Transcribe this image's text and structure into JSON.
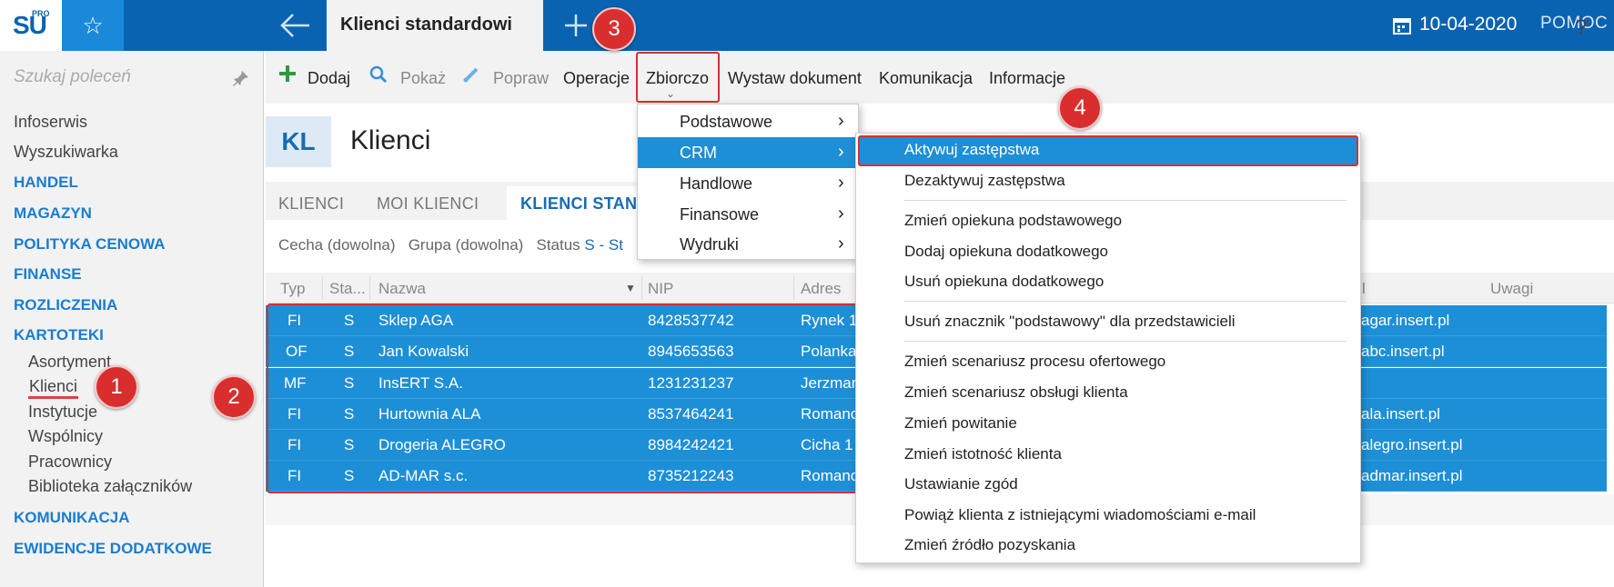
{
  "topbar": {
    "logo": "SU",
    "logo_sup": "PRO",
    "tab_title": "Klienci standardowi",
    "date": "10-04-2020",
    "help": "POMOC"
  },
  "sidebar": {
    "search_placeholder": "Szukaj poleceń",
    "items": [
      "Infoserwis",
      "Wyszukiwarka"
    ],
    "sections": [
      "HANDEL",
      "MAGAZYN",
      "POLITYKA CENOWA",
      "FINANSE",
      "ROZLICZENIA",
      "KARTOTEKI"
    ],
    "kartoteki_items": [
      "Asortyment",
      "Klienci",
      "Instytucje",
      "Wspólnicy",
      "Pracownicy",
      "Biblioteka załączników"
    ],
    "bottom_sections": [
      "KOMUNIKACJA",
      "EWIDENCJE DODATKOWE"
    ]
  },
  "toolbar": {
    "add": "Dodaj",
    "show": "Pokaż",
    "edit": "Popraw",
    "operations": "Operacje",
    "bulk": "Zbiorczo",
    "issue_document": "Wystaw dokument",
    "communication": "Komunikacja",
    "information": "Informacje",
    "help": "?"
  },
  "page": {
    "badge": "KL",
    "title": "Klienci"
  },
  "tabs": [
    "KLIENCI",
    "MOI KLIENCI",
    "KLIENCI STAN"
  ],
  "filters": {
    "feature": "Cecha (dowolna)",
    "group": "Grupa (dowolna)",
    "status_label": "Status",
    "status_value": "S - St"
  },
  "grid": {
    "headers": [
      "Typ",
      "Sta...",
      "Nazwa",
      "NIP",
      "Adres",
      "l",
      "Uwagi"
    ],
    "rows": [
      {
        "type": "FI",
        "status": "S",
        "name": "Sklep AGA",
        "nip": "8428537742",
        "address": "Rynek 1",
        "email": "agar.insert.pl"
      },
      {
        "type": "OF",
        "status": "S",
        "name": "Jan Kowalski",
        "nip": "8945653563",
        "address": "Polanka",
        "email": "abc.insert.pl"
      },
      {
        "type": "MF",
        "status": "S",
        "name": "InsERT S.A.",
        "nip": "1231231237",
        "address": "Jerzmar",
        "email": ""
      },
      {
        "type": "FI",
        "status": "S",
        "name": "Hurtownia ALA",
        "nip": "8537464241",
        "address": "Romanc",
        "email": "ala.insert.pl"
      },
      {
        "type": "FI",
        "status": "S",
        "name": "Drogeria ALEGRO",
        "nip": "8984242421",
        "address": "Cicha  1",
        "email": "alegro.insert.pl"
      },
      {
        "type": "FI",
        "status": "S",
        "name": "AD-MAR s.c.",
        "nip": "8735212243",
        "address": "Romanc",
        "email": "admar.insert.pl"
      }
    ]
  },
  "menu_bulk": [
    {
      "label": "Podstawowe",
      "arrow": "›"
    },
    {
      "label": "CRM",
      "arrow": "›"
    },
    {
      "label": "Handlowe",
      "arrow": "›"
    },
    {
      "label": "Finansowe",
      "arrow": "›"
    },
    {
      "label": "Wydruki",
      "arrow": "›"
    }
  ],
  "menu_crm": [
    "Aktywuj zastępstwa",
    "Dezaktywuj zastępstwa",
    "Zmień opiekuna podstawowego",
    "Dodaj opiekuna dodatkowego",
    "Usuń opiekuna dodatkowego",
    "Usuń znacznik \"podstawowy\" dla przedstawicieli",
    "Zmień scenariusz procesu ofertowego",
    "Zmień scenariusz obsługi klienta",
    "Zmień powitanie",
    "Zmień istotność klienta",
    "Ustawianie zgód",
    "Powiąż klienta z istniejącymi wiadomościami e-mail",
    "Zmień źródło pozyskania"
  ],
  "callouts": [
    "1",
    "2",
    "3",
    "4"
  ]
}
